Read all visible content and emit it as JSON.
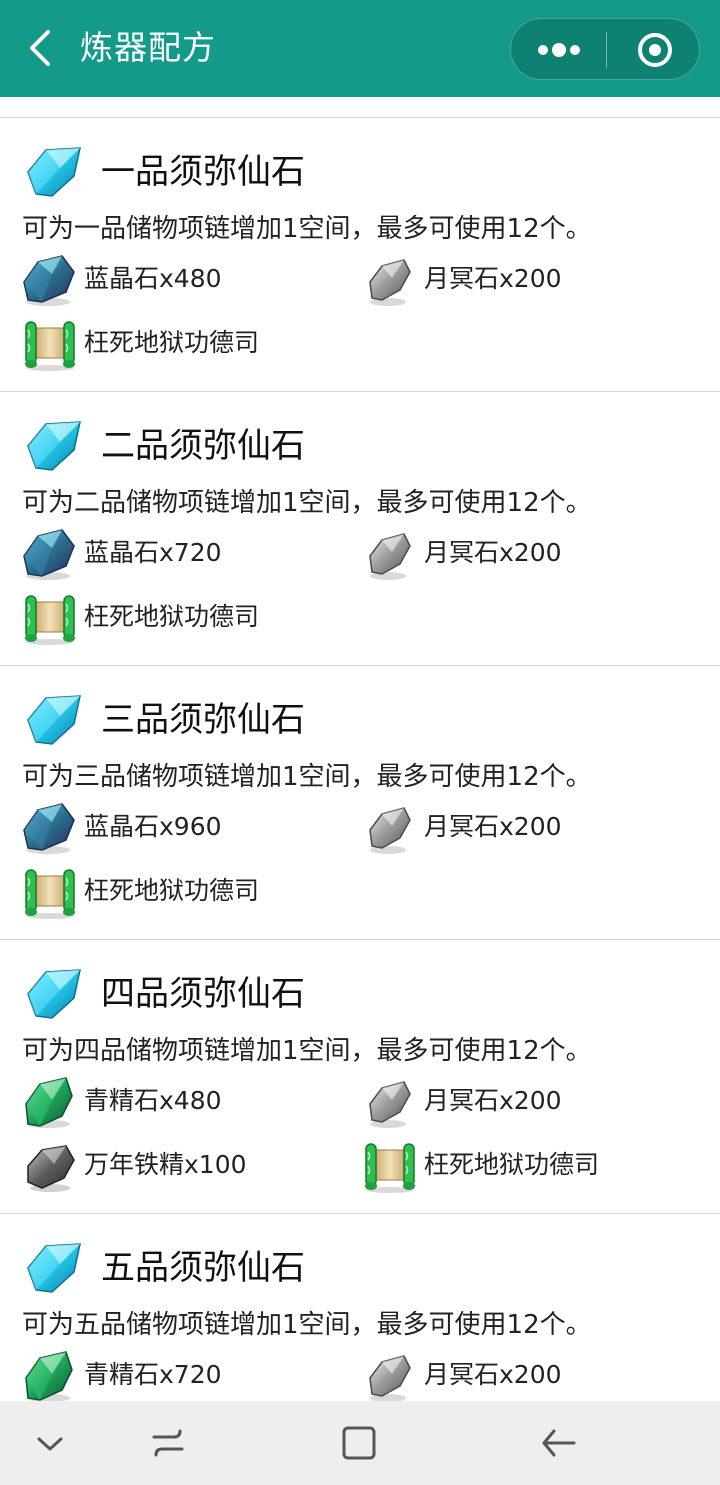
{
  "header": {
    "title": "炼器配方",
    "back_icon": "chevron-left-icon",
    "more_icon": "more-dots-icon",
    "target_icon": "target-icon",
    "bg_color": "#139a8a"
  },
  "recipes": [
    {
      "title": "一品须弥仙石",
      "desc": "可为一品储物项链增加1空间，最多可使用12个。",
      "materials": [
        {
          "label": "蓝晶石x480",
          "icon": "blue-crystal-icon"
        },
        {
          "label": "月冥石x200",
          "icon": "grey-stone-icon"
        },
        {
          "label": "枉死地狱功德司",
          "icon": "scroll-icon"
        }
      ]
    },
    {
      "title": "二品须弥仙石",
      "desc": "可为二品储物项链增加1空间，最多可使用12个。",
      "materials": [
        {
          "label": "蓝晶石x720",
          "icon": "blue-crystal-icon"
        },
        {
          "label": "月冥石x200",
          "icon": "grey-stone-icon"
        },
        {
          "label": "枉死地狱功德司",
          "icon": "scroll-icon"
        }
      ]
    },
    {
      "title": "三品须弥仙石",
      "desc": "可为三品储物项链增加1空间，最多可使用12个。",
      "materials": [
        {
          "label": "蓝晶石x960",
          "icon": "blue-crystal-icon"
        },
        {
          "label": "月冥石x200",
          "icon": "grey-stone-icon"
        },
        {
          "label": "枉死地狱功德司",
          "icon": "scroll-icon"
        }
      ]
    },
    {
      "title": "四品须弥仙石",
      "desc": "可为四品储物项链增加1空间，最多可使用12个。",
      "materials": [
        {
          "label": "青精石x480",
          "icon": "green-crystal-icon"
        },
        {
          "label": "月冥石x200",
          "icon": "grey-stone-icon"
        },
        {
          "label": "万年铁精x100",
          "icon": "iron-ore-icon"
        },
        {
          "label": "枉死地狱功德司",
          "icon": "scroll-icon"
        }
      ]
    },
    {
      "title": "五品须弥仙石",
      "desc": "可为五品储物项链增加1空间，最多可使用12个。",
      "materials": [
        {
          "label": "青精石x720",
          "icon": "green-crystal-icon"
        },
        {
          "label": "月冥石x200",
          "icon": "grey-stone-icon"
        }
      ]
    }
  ],
  "navbar": {
    "icons": [
      "chevron-down-icon",
      "recent-apps-icon",
      "home-square-icon",
      "back-arrow-icon"
    ]
  }
}
